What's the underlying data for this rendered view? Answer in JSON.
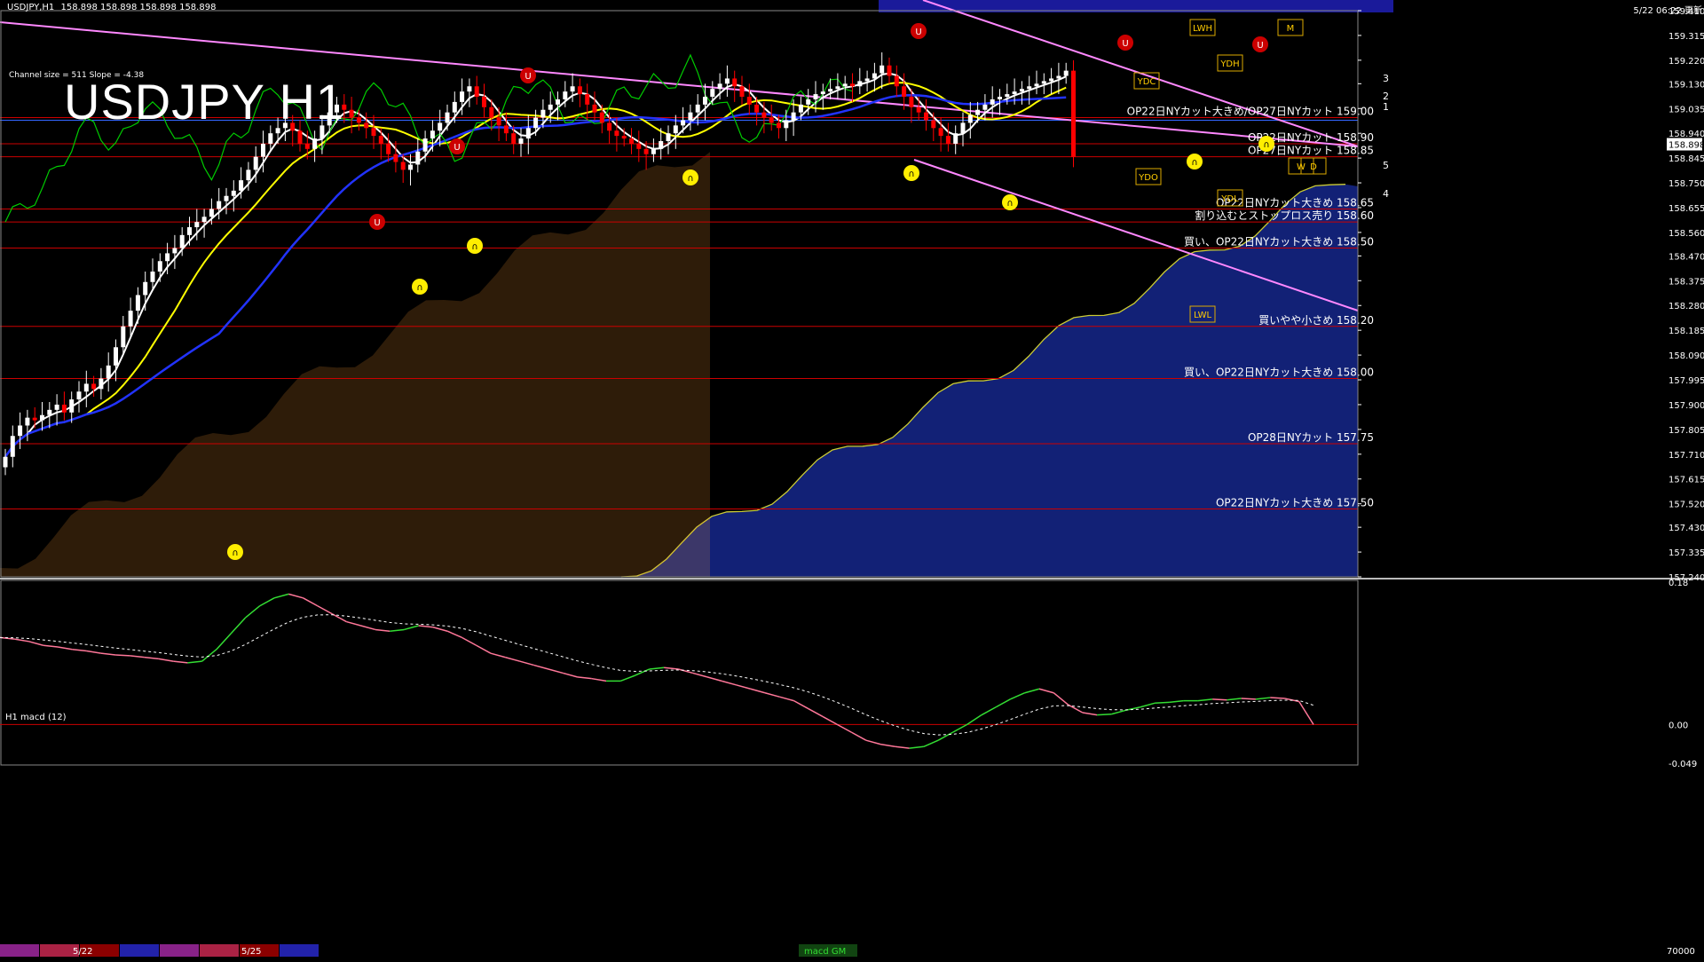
{
  "window": {
    "symbol_header": "USDJPY,H1",
    "ohlc_header": "158.898 158.898 158.898 158.898",
    "time_header": "5/22 06:22 更新",
    "title": "USDJPY H1",
    "channel_info": "Channel size = 511 Slope = -4.38",
    "macd_label": "H1  macd (12)",
    "macd_tab_label": "macd GM",
    "bottom_dates": [
      "5/22",
      "5/25"
    ],
    "bottom_right_value": "70000"
  },
  "colors": {
    "background": "#000000",
    "bull_candle": "#ffffff",
    "bear_candle": "#ff0000",
    "ma_fast": "#ffffff",
    "ma_mid": "#ffff00",
    "ma_slow": "#2233ff",
    "channel": "#ff88ff",
    "chikou": "#00cc00",
    "cloud_blue": "#1a2fa8",
    "cloud_orange": "#ff9933",
    "level_line": "#cc0000",
    "macd_up": "#33dd33",
    "macd_down": "#ff7799",
    "signal": "#ffffff"
  },
  "chart_data": [
    {
      "type": "candlestick",
      "title": "USDJPY H1",
      "ylim": [
        157.24,
        159.41
      ],
      "y_ticks": [
        "159.410",
        "159.315",
        "159.220",
        "159.130",
        "159.035",
        "158.940",
        "158.845",
        "158.750",
        "158.655",
        "158.560",
        "158.470",
        "158.375",
        "158.280",
        "158.185",
        "158.090",
        "157.995",
        "157.900",
        "157.805",
        "157.710",
        "157.615",
        "157.520",
        "157.430",
        "157.335",
        "157.240"
      ],
      "current_price": "158.898",
      "candles_close": [
        157.7,
        157.78,
        157.82,
        157.85,
        157.84,
        157.86,
        157.88,
        157.9,
        157.87,
        157.92,
        157.95,
        157.98,
        157.96,
        158.0,
        158.05,
        158.12,
        158.2,
        158.26,
        158.32,
        158.37,
        158.41,
        158.45,
        158.48,
        158.5,
        158.55,
        158.58,
        158.6,
        158.62,
        158.65,
        158.68,
        158.7,
        158.72,
        158.76,
        158.8,
        158.85,
        158.9,
        158.94,
        158.96,
        158.98,
        158.95,
        158.9,
        158.88,
        158.92,
        158.97,
        159.02,
        159.05,
        159.03,
        159.0,
        158.98,
        158.96,
        158.93,
        158.9,
        158.86,
        158.83,
        158.8,
        158.82,
        158.87,
        158.92,
        158.95,
        158.98,
        159.02,
        159.06,
        159.1,
        159.12,
        159.08,
        159.04,
        159.0,
        158.97,
        158.94,
        158.9,
        158.92,
        158.96,
        159.0,
        159.03,
        159.05,
        159.07,
        159.1,
        159.12,
        159.09,
        159.05,
        159.02,
        158.98,
        158.95,
        158.93,
        158.92,
        158.9,
        158.88,
        158.86,
        158.88,
        158.91,
        158.94,
        158.97,
        158.99,
        159.02,
        159.05,
        159.08,
        159.11,
        159.13,
        159.15,
        159.12,
        159.08,
        159.05,
        159.02,
        159.0,
        158.98,
        158.96,
        158.99,
        159.02,
        159.05,
        159.07,
        159.09,
        159.1,
        159.11,
        159.12,
        159.13,
        159.12,
        159.14,
        159.15,
        159.17,
        159.2,
        159.16,
        159.12,
        159.08,
        159.04,
        159.02,
        158.99,
        158.96,
        158.93,
        158.9,
        158.94,
        158.98,
        159.01,
        159.03,
        159.05,
        159.07,
        159.08,
        159.09,
        159.1,
        159.11,
        159.12,
        159.13,
        159.14,
        159.15,
        159.16,
        159.18,
        158.85
      ],
      "levels": [
        {
          "price": 159.0,
          "label": "OP22日NYカット大きめ/OP27日NYカット 159.00"
        },
        {
          "price": 158.9,
          "label": "OP22日NYカット 158.90"
        },
        {
          "price": 158.85,
          "label": "OP27日NYカット 158.85"
        },
        {
          "price": 158.65,
          "label": "OP22日NYカット大きめ 158.65"
        },
        {
          "price": 158.6,
          "label": "割り込むとストップロス売り 158.60"
        },
        {
          "price": 158.5,
          "label": "買い、OP22日NYカット大きめ 158.50"
        },
        {
          "price": 158.2,
          "label": "買いやや小さめ 158.20"
        },
        {
          "price": 158.0,
          "label": "買い、OP22日NYカット大きめ 158.00"
        },
        {
          "price": 157.75,
          "label": "OP28日NYカット 157.75"
        },
        {
          "price": 157.5,
          "label": "OP22日NYカット大きめ 157.50"
        }
      ],
      "channel_labels": [
        "3",
        "2",
        "1",
        "5",
        "4"
      ],
      "markers": [
        "YDC",
        "YDO",
        "YDH",
        "YDL",
        "LWH",
        "LWL",
        "W",
        "D",
        "M"
      ]
    },
    {
      "type": "line",
      "title": "H1  macd (12)",
      "ylim": [
        -0.049,
        0.18
      ],
      "y_ticks": [
        "0.18",
        "0.00",
        "-0.049"
      ],
      "series": [
        {
          "name": "macd",
          "values": [
            0.11,
            0.108,
            0.105,
            0.1,
            0.098,
            0.095,
            0.093,
            0.09,
            0.088,
            0.087,
            0.085,
            0.083,
            0.08,
            0.078,
            0.08,
            0.095,
            0.115,
            0.135,
            0.15,
            0.16,
            0.165,
            0.16,
            0.15,
            0.14,
            0.13,
            0.125,
            0.12,
            0.118,
            0.12,
            0.125,
            0.123,
            0.118,
            0.11,
            0.1,
            0.09,
            0.085,
            0.08,
            0.075,
            0.07,
            0.065,
            0.06,
            0.058,
            0.055,
            0.055,
            0.062,
            0.07,
            0.072,
            0.07,
            0.065,
            0.06,
            0.055,
            0.05,
            0.045,
            0.04,
            0.035,
            0.03,
            0.02,
            0.01,
            0.0,
            -0.01,
            -0.02,
            -0.025,
            -0.028,
            -0.03,
            -0.028,
            -0.02,
            -0.01,
            0.0,
            0.012,
            0.022,
            0.032,
            0.04,
            0.045,
            0.04,
            0.025,
            0.015,
            0.012,
            0.013,
            0.018,
            0.022,
            0.027,
            0.028,
            0.03,
            0.03,
            0.032,
            0.031,
            0.033,
            0.032,
            0.034,
            0.033,
            0.029,
            0.0
          ]
        }
      ]
    }
  ]
}
